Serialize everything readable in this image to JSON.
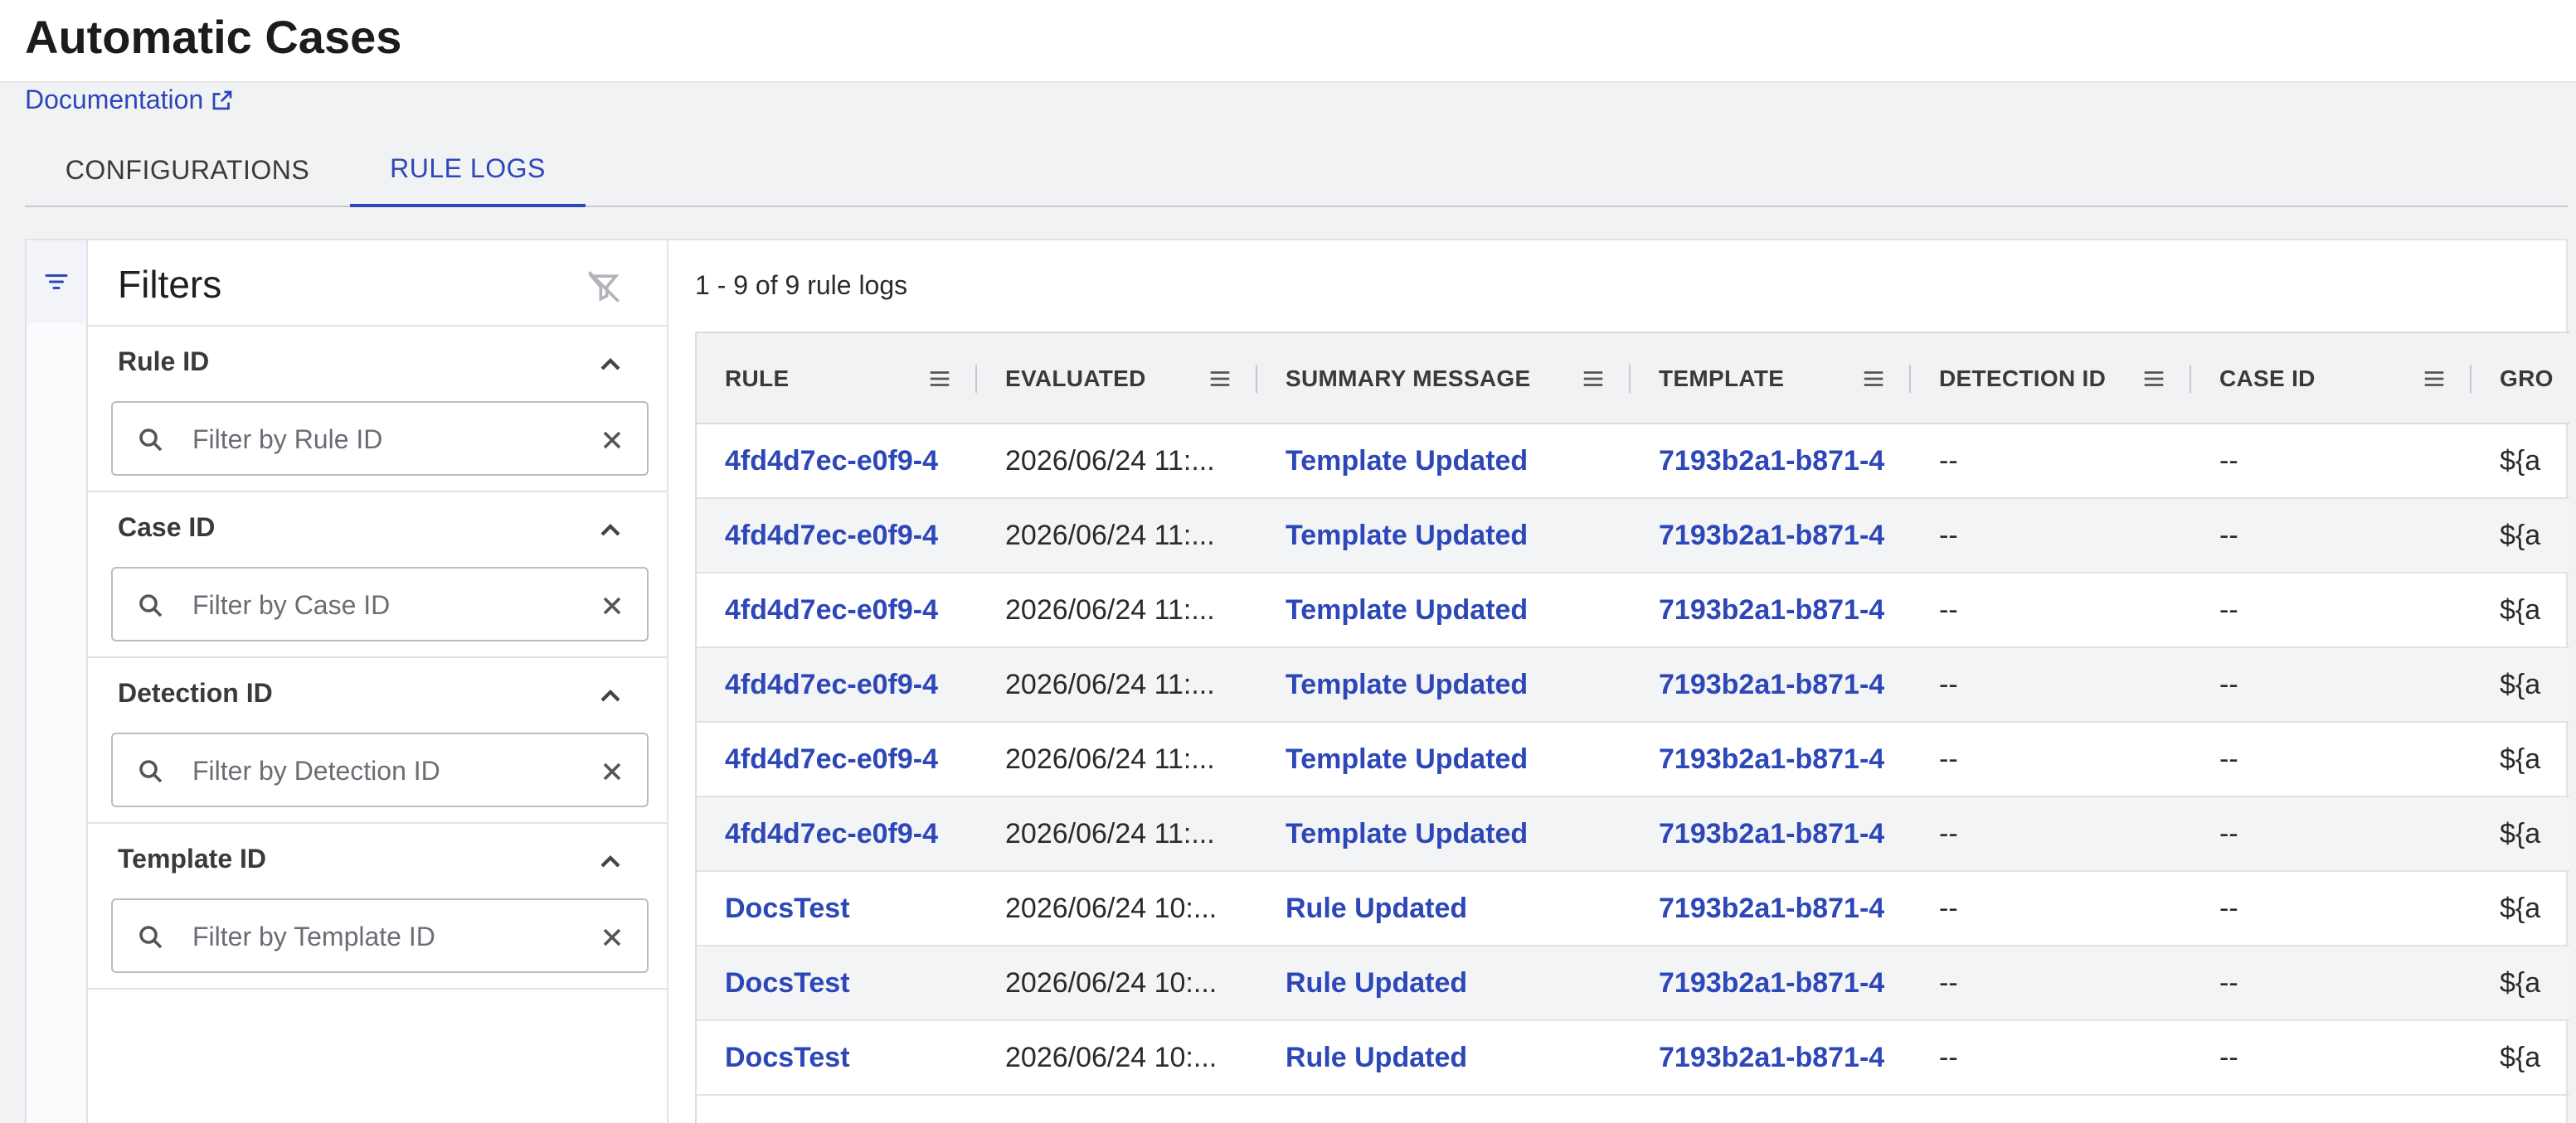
{
  "page": {
    "title": "Automatic Cases",
    "doc_link": "Documentation"
  },
  "tabs": [
    {
      "label": "CONFIGURATIONS"
    },
    {
      "label": "RULE LOGS"
    }
  ],
  "filters": {
    "title": "Filters",
    "groups": [
      {
        "label": "Rule ID",
        "placeholder": "Filter by Rule ID"
      },
      {
        "label": "Case ID",
        "placeholder": "Filter by Case ID"
      },
      {
        "label": "Detection ID",
        "placeholder": "Filter by Detection ID"
      },
      {
        "label": "Template ID",
        "placeholder": "Filter by Template ID"
      }
    ]
  },
  "table": {
    "count_label": "1 - 9 of 9 rule logs",
    "columns": [
      "RULE",
      "EVALUATED",
      "SUMMARY MESSAGE",
      "TEMPLATE",
      "DETECTION ID",
      "CASE ID",
      "GRO"
    ],
    "rows": [
      [
        "4fd4d7ec-e0f9-4",
        "2026/06/24 11:...",
        "Template Updated",
        "7193b2a1-b871-4",
        "--",
        "--",
        "${a"
      ],
      [
        "4fd4d7ec-e0f9-4",
        "2026/06/24 11:...",
        "Template Updated",
        "7193b2a1-b871-4",
        "--",
        "--",
        "${a"
      ],
      [
        "4fd4d7ec-e0f9-4",
        "2026/06/24 11:...",
        "Template Updated",
        "7193b2a1-b871-4",
        "--",
        "--",
        "${a"
      ],
      [
        "4fd4d7ec-e0f9-4",
        "2026/06/24 11:...",
        "Template Updated",
        "7193b2a1-b871-4",
        "--",
        "--",
        "${a"
      ],
      [
        "4fd4d7ec-e0f9-4",
        "2026/06/24 11:...",
        "Template Updated",
        "7193b2a1-b871-4",
        "--",
        "--",
        "${a"
      ],
      [
        "4fd4d7ec-e0f9-4",
        "2026/06/24 11:...",
        "Template Updated",
        "7193b2a1-b871-4",
        "--",
        "--",
        "${a"
      ],
      [
        "DocsTest",
        "2026/06/24 10:...",
        "Rule Updated",
        "7193b2a1-b871-4",
        "--",
        "--",
        "${a"
      ],
      [
        "DocsTest",
        "2026/06/24 10:...",
        "Rule Updated",
        "7193b2a1-b871-4",
        "--",
        "--",
        "${a"
      ],
      [
        "DocsTest",
        "2026/06/24 10:...",
        "Rule Updated",
        "7193b2a1-b871-4",
        "--",
        "--",
        "${a"
      ]
    ]
  },
  "icons": {
    "external_link": "external-link-icon",
    "filter": "filter-icon",
    "clear_filter": "filter-off-icon",
    "collapse": "chevron-up-icon",
    "search": "search-icon",
    "clear": "close-icon",
    "column_menu": "menu-icon"
  },
  "colors": {
    "accent": "#2d47b8",
    "text": "#1f1f1f",
    "border": "#e1e2e6"
  }
}
